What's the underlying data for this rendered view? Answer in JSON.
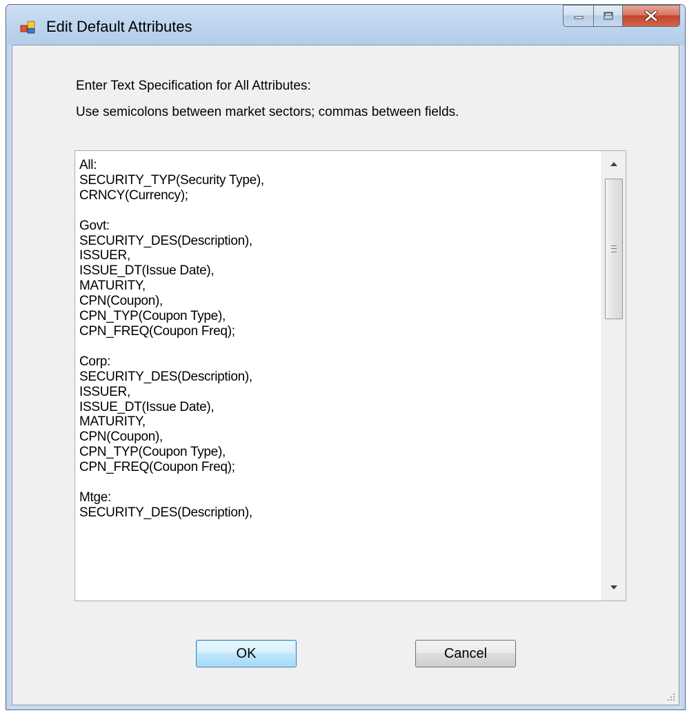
{
  "window": {
    "title": "Edit Default Attributes",
    "caption_buttons": [
      "minimize-icon",
      "maximize-icon",
      "close-icon"
    ]
  },
  "dialog": {
    "instruction_line1": "Enter Text Specification for All Attributes:",
    "instruction_line2": "Use semicolons between market sectors; commas between fields.",
    "spec_text": "All:\nSECURITY_TYP(Security Type),\nCRNCY(Currency);\n\nGovt:\nSECURITY_DES(Description),\nISSUER,\nISSUE_DT(Issue Date),\nMATURITY,\nCPN(Coupon),\nCPN_TYP(Coupon Type),\nCPN_FREQ(Coupon Freq);\n\nCorp:\nSECURITY_DES(Description),\nISSUER,\nISSUE_DT(Issue Date),\nMATURITY,\nCPN(Coupon),\nCPN_TYP(Coupon Type),\nCPN_FREQ(Coupon Freq);\n\nMtge:\nSECURITY_DES(Description),",
    "ok_label": "OK",
    "cancel_label": "Cancel"
  },
  "colors": {
    "title_bar": "#bed5ee",
    "dialog_bg": "#f0f0f0",
    "close_button": "#c4432b",
    "ok_button_border": "#3c7fb1"
  }
}
